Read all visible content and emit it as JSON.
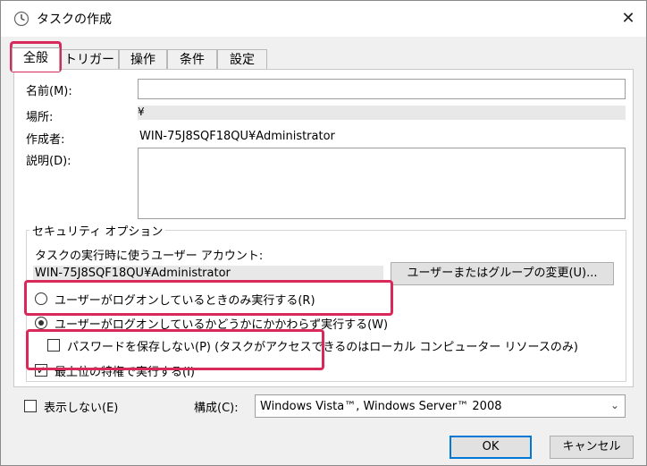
{
  "window": {
    "title": "タスクの作成",
    "close_glyph": "✕"
  },
  "tabs": [
    {
      "label": "全般",
      "active": true
    },
    {
      "label": "トリガー"
    },
    {
      "label": "操作"
    },
    {
      "label": "条件"
    },
    {
      "label": "設定"
    }
  ],
  "general": {
    "name_label": "名前(M):",
    "name_value": "",
    "location_label": "場所:",
    "location_value": "¥",
    "author_label": "作成者:",
    "author_value": "WIN-75J8SQF18QU¥Administrator",
    "description_label": "説明(D):",
    "description_value": ""
  },
  "security": {
    "group_title": "セキュリティ オプション",
    "account_prompt": "タスクの実行時に使うユーザー アカウント:",
    "account_value": "WIN-75J8SQF18QU¥Administrator",
    "change_button": "ユーザーまたはグループの変更(U)...",
    "radio_only_logged_on": "ユーザーがログオンしているときのみ実行する(R)",
    "radio_whether_logged_on": "ユーザーがログオンしているかどうかにかかわらず実行する(W)",
    "no_store_password": "パスワードを保存しない(P) (タスクがアクセスできるのはローカル コンピューター リソースのみ)",
    "highest_privileges": "最上位の特権で実行する(I)"
  },
  "footer": {
    "hidden_label": "表示しない(E)",
    "configure_label": "構成(C):",
    "configure_value": "Windows Vista™, Windows Server™ 2008",
    "ok": "OK",
    "cancel": "キャンセル"
  },
  "colors": {
    "highlight": "#d9295a",
    "accent": "#0078d7"
  }
}
